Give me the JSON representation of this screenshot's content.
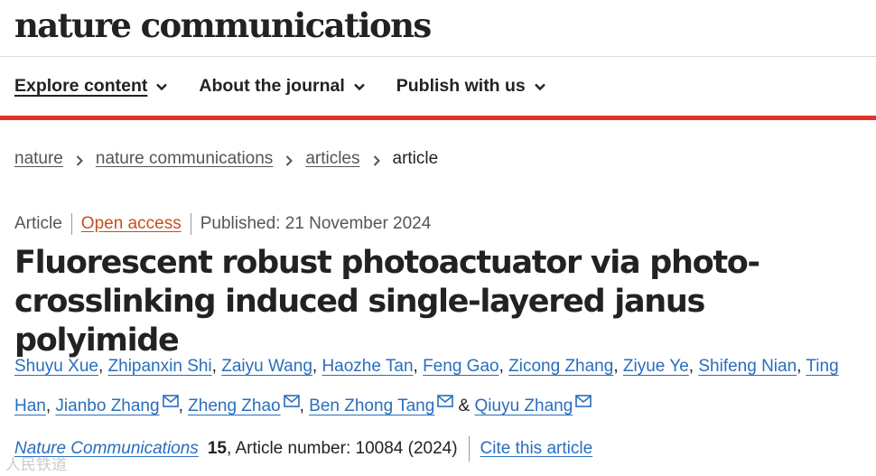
{
  "site": {
    "logo": "nature communications"
  },
  "nav": {
    "items": [
      {
        "label": "Explore content"
      },
      {
        "label": "About the journal"
      },
      {
        "label": "Publish with us"
      }
    ]
  },
  "breadcrumb": {
    "items": [
      "nature",
      "nature communications",
      "articles"
    ],
    "current": "article"
  },
  "article_meta": {
    "type": "Article",
    "access": "Open access",
    "published": "Published: 21 November 2024"
  },
  "article": {
    "title": "Fluorescent robust photoactuator via photo-crosslinking induced single-layered janus polyimide",
    "authors": [
      {
        "name": "Shuyu Xue",
        "email": false
      },
      {
        "name": "Zhipanxin Shi",
        "email": false
      },
      {
        "name": "Zaiyu Wang",
        "email": false
      },
      {
        "name": "Haozhe Tan",
        "email": false
      },
      {
        "name": "Feng Gao",
        "email": false
      },
      {
        "name": "Zicong Zhang",
        "email": false
      },
      {
        "name": "Ziyue Ye",
        "email": false
      },
      {
        "name": "Shifeng Nian",
        "email": false
      },
      {
        "name": "Ting Han",
        "email": false
      },
      {
        "name": "Jianbo Zhang",
        "email": true
      },
      {
        "name": "Zheng Zhao",
        "email": true
      },
      {
        "name": "Ben Zhong Tang",
        "email": true
      },
      {
        "name": "Qiuyu Zhang",
        "email": true
      }
    ],
    "author_separator": ", ",
    "author_last_separator": " & "
  },
  "citation": {
    "journal": "Nature Communications",
    "volume": "15",
    "article_number": ", Article number: 10084 (2024)",
    "cite_label": "Cite this article"
  },
  "watermark": "人民铁道",
  "icons": {
    "nav": "chevron-down-icon",
    "breadcrumb": "chevron-right-icon",
    "author": "mail-icon"
  },
  "colors": {
    "accent_red": "#e4322b",
    "link_blue": "#2a6ebb",
    "open_access_orange": "#c74e1c"
  }
}
